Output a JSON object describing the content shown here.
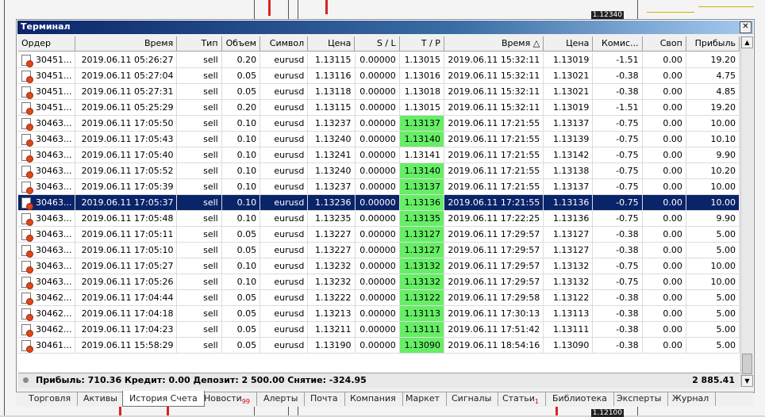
{
  "window": {
    "title": "Терминал",
    "close_icon": "close-icon"
  },
  "columns": [
    "Ордер",
    "Время",
    "Тип",
    "Объем",
    "Символ",
    "Цена",
    "S / L",
    "T / P",
    "Время",
    "Цена",
    "Комис...",
    "Своп",
    "Прибыль"
  ],
  "rows": [
    [
      "30451...",
      "2019.06.11 05:26:27",
      "sell",
      "0.20",
      "eurusd",
      "1.13115",
      "0.00000",
      "1.13015",
      "2019.06.11 15:32:11",
      "1.13019",
      "-1.51",
      "0.00",
      "19.20"
    ],
    [
      "30451...",
      "2019.06.11 05:27:04",
      "sell",
      "0.05",
      "eurusd",
      "1.13116",
      "0.00000",
      "1.13016",
      "2019.06.11 15:32:11",
      "1.13021",
      "-0.38",
      "0.00",
      "4.75"
    ],
    [
      "30451...",
      "2019.06.11 05:27:31",
      "sell",
      "0.05",
      "eurusd",
      "1.13118",
      "0.00000",
      "1.13018",
      "2019.06.11 15:32:11",
      "1.13021",
      "-0.38",
      "0.00",
      "4.85"
    ],
    [
      "30451...",
      "2019.06.11 05:25:29",
      "sell",
      "0.20",
      "eurusd",
      "1.13115",
      "0.00000",
      "1.13015",
      "2019.06.11 15:32:11",
      "1.13019",
      "-1.51",
      "0.00",
      "19.20"
    ],
    [
      "30463...",
      "2019.06.11 17:05:50",
      "sell",
      "0.10",
      "eurusd",
      "1.13237",
      "0.00000",
      "1.13137",
      "2019.06.11 17:21:55",
      "1.13137",
      "-0.75",
      "0.00",
      "10.00"
    ],
    [
      "30463...",
      "2019.06.11 17:05:43",
      "sell",
      "0.10",
      "eurusd",
      "1.13240",
      "0.00000",
      "1.13140",
      "2019.06.11 17:21:55",
      "1.13139",
      "-0.75",
      "0.00",
      "10.10"
    ],
    [
      "30463...",
      "2019.06.11 17:05:40",
      "sell",
      "0.10",
      "eurusd",
      "1.13241",
      "0.00000",
      "1.13141",
      "2019.06.11 17:21:55",
      "1.13142",
      "-0.75",
      "0.00",
      "9.90"
    ],
    [
      "30463...",
      "2019.06.11 17:05:52",
      "sell",
      "0.10",
      "eurusd",
      "1.13240",
      "0.00000",
      "1.13140",
      "2019.06.11 17:21:55",
      "1.13138",
      "-0.75",
      "0.00",
      "10.20"
    ],
    [
      "30463...",
      "2019.06.11 17:05:39",
      "sell",
      "0.10",
      "eurusd",
      "1.13237",
      "0.00000",
      "1.13137",
      "2019.06.11 17:21:55",
      "1.13137",
      "-0.75",
      "0.00",
      "10.00"
    ],
    [
      "30463...",
      "2019.06.11 17:05:37",
      "sell",
      "0.10",
      "eurusd",
      "1.13236",
      "0.00000",
      "1.13136",
      "2019.06.11 17:21:55",
      "1.13136",
      "-0.75",
      "0.00",
      "10.00"
    ],
    [
      "30463...",
      "2019.06.11 17:05:48",
      "sell",
      "0.10",
      "eurusd",
      "1.13235",
      "0.00000",
      "1.13135",
      "2019.06.11 17:22:25",
      "1.13136",
      "-0.75",
      "0.00",
      "9.90"
    ],
    [
      "30463...",
      "2019.06.11 17:05:11",
      "sell",
      "0.05",
      "eurusd",
      "1.13227",
      "0.00000",
      "1.13127",
      "2019.06.11 17:29:57",
      "1.13127",
      "-0.38",
      "0.00",
      "5.00"
    ],
    [
      "30463...",
      "2019.06.11 17:05:10",
      "sell",
      "0.05",
      "eurusd",
      "1.13227",
      "0.00000",
      "1.13127",
      "2019.06.11 17:29:57",
      "1.13127",
      "-0.38",
      "0.00",
      "5.00"
    ],
    [
      "30463...",
      "2019.06.11 17:05:27",
      "sell",
      "0.10",
      "eurusd",
      "1.13232",
      "0.00000",
      "1.13132",
      "2019.06.11 17:29:57",
      "1.13132",
      "-0.75",
      "0.00",
      "10.00"
    ],
    [
      "30463...",
      "2019.06.11 17:05:26",
      "sell",
      "0.10",
      "eurusd",
      "1.13232",
      "0.00000",
      "1.13132",
      "2019.06.11 17:29:57",
      "1.13132",
      "-0.75",
      "0.00",
      "10.00"
    ],
    [
      "30462...",
      "2019.06.11 17:04:44",
      "sell",
      "0.05",
      "eurusd",
      "1.13222",
      "0.00000",
      "1.13122",
      "2019.06.11 17:29:58",
      "1.13122",
      "-0.38",
      "0.00",
      "5.00"
    ],
    [
      "30462...",
      "2019.06.11 17:04:18",
      "sell",
      "0.05",
      "eurusd",
      "1.13213",
      "0.00000",
      "1.13113",
      "2019.06.11 17:30:13",
      "1.13113",
      "-0.38",
      "0.00",
      "5.00"
    ],
    [
      "30462...",
      "2019.06.11 17:04:23",
      "sell",
      "0.05",
      "eurusd",
      "1.13211",
      "0.00000",
      "1.13111",
      "2019.06.11 17:51:42",
      "1.13111",
      "-0.38",
      "0.00",
      "5.00"
    ],
    [
      "30461...",
      "2019.06.11 15:58:29",
      "sell",
      "0.05",
      "eurusd",
      "1.13190",
      "0.00000",
      "1.13090",
      "2019.06.11 18:54:16",
      "1.13090",
      "-0.38",
      "0.00",
      "5.00"
    ]
  ],
  "tp_highlight_rows": [
    4,
    5,
    7,
    8,
    9,
    10,
    11,
    12,
    13,
    14,
    15,
    16,
    17,
    18
  ],
  "selected_row": 9,
  "summary": {
    "text": "Прибыль: 710.36  Кредит: 0.00  Депозит: 2 500.00  Снятие: -324.95",
    "total": "2 885.41"
  },
  "tabs": [
    {
      "label": "Торговля"
    },
    {
      "label": "Активы"
    },
    {
      "label": "История Счета",
      "active": true
    },
    {
      "label": "Новости",
      "badge": "99"
    },
    {
      "label": "Алерты"
    },
    {
      "label": "Почта"
    },
    {
      "label": "Компания"
    },
    {
      "label": "Маркет"
    },
    {
      "label": "Сигналы"
    },
    {
      "label": "Статьи",
      "badge": "1"
    },
    {
      "label": "Библиотека"
    },
    {
      "label": "Эксперты"
    },
    {
      "label": "Журнал"
    }
  ],
  "background_prices": [
    "1.12340",
    "1.12100"
  ],
  "colors": {
    "selection": "#0a246a",
    "tp_hit": "#66ee66",
    "title_bar": "#0a246a"
  }
}
